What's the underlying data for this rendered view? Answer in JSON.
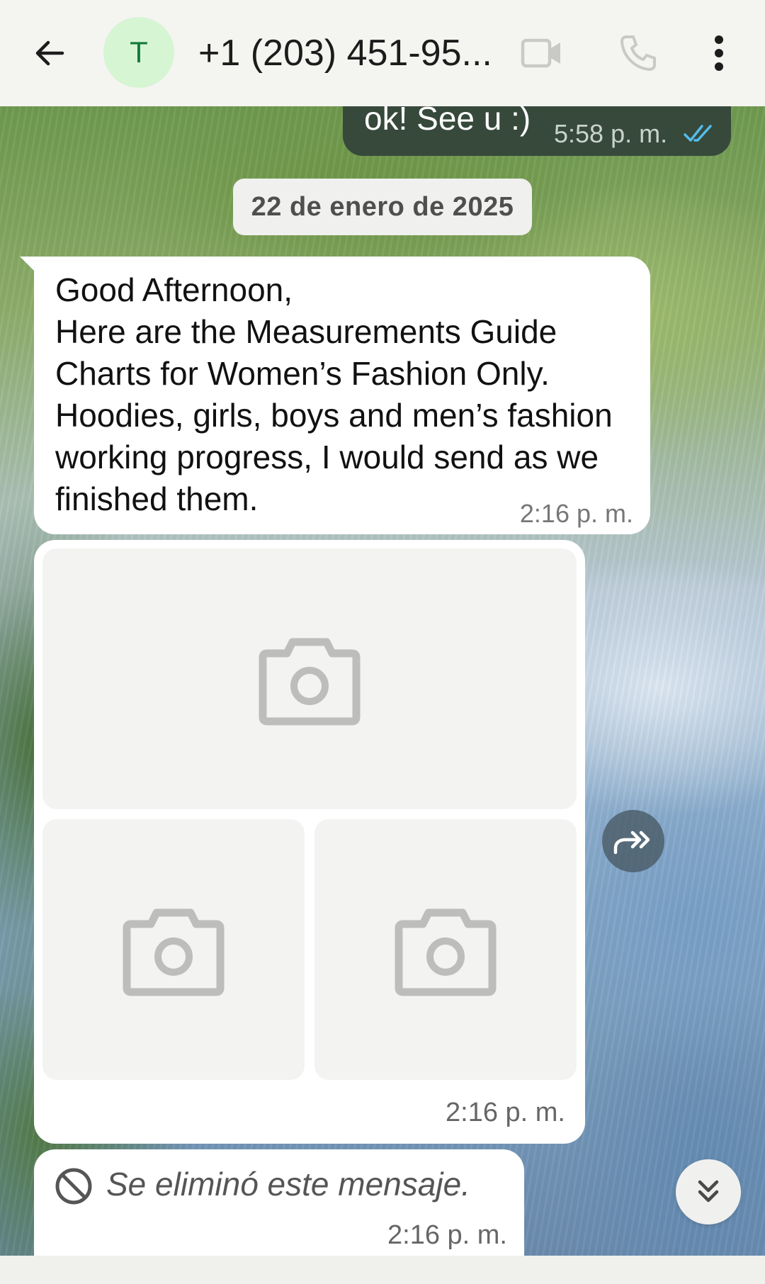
{
  "header": {
    "back_icon": "arrow-left-icon",
    "avatar_letter": "T",
    "contact_name": "+1 (203) 451-95...",
    "video_icon": "video-camera-icon",
    "call_icon": "phone-icon",
    "menu_icon": "more-vertical-icon"
  },
  "messages": {
    "outgoing_partial": {
      "text": "ok! See u :)",
      "time": "5:58 p. m.",
      "status_icon": "double-check-icon"
    },
    "date_separator": "22 de enero de 2025",
    "incoming_text": {
      "text": "Good Afternoon,\nHere are the Measurements Guide Charts for Women’s Fashion Only. Hoodies, girls, boys and men’s fashion working progress, I would send as we finished them.",
      "time": "2:16 p. m."
    },
    "album": {
      "image_placeholder_icon": "camera-icon",
      "image_count": 3,
      "time": "2:16 p. m."
    },
    "deleted": {
      "icon": "blocked-icon",
      "text": "Se eliminó este mensaje.",
      "time": "2:16 p. m."
    }
  },
  "controls": {
    "forward_icon": "forward-icon",
    "scroll_down_icon": "double-chevron-down-icon"
  },
  "colors": {
    "outgoing_bubble": "#36493b",
    "incoming_bubble": "#ffffff",
    "avatar_bg": "#d6f5d3",
    "avatar_text": "#137a3a",
    "read_ticks": "#53bdeb"
  }
}
